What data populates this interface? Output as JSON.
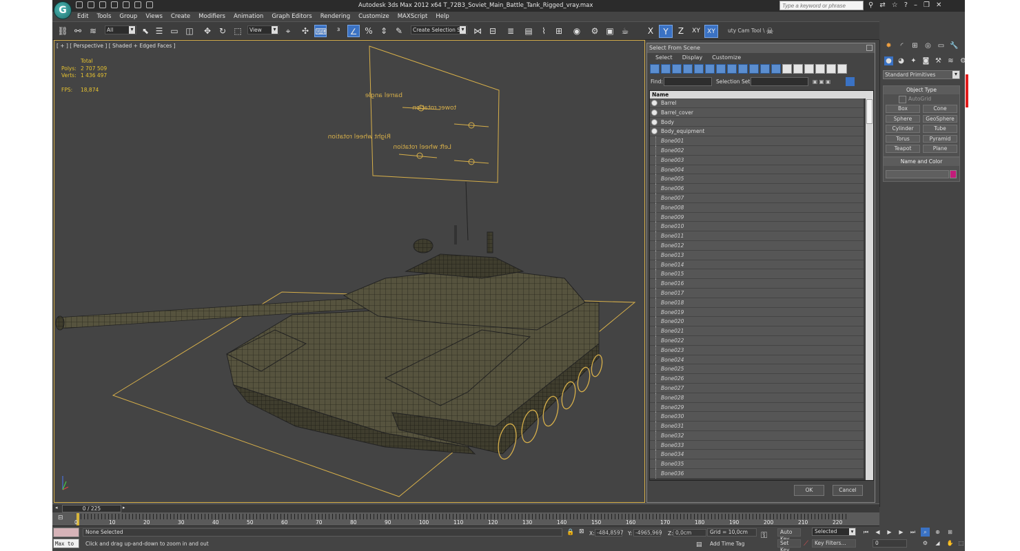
{
  "window": {
    "title": "Autodesk 3ds Max  2012 x64     T_72B3_Soviet_Main_Battle_Tank_Rigged_vray.max",
    "search_placeholder": "Type a keyword or phrase"
  },
  "menu": [
    "Edit",
    "Tools",
    "Group",
    "Views",
    "Create",
    "Modifiers",
    "Animation",
    "Graph Editors",
    "Rendering",
    "Customize",
    "MAXScript",
    "Help"
  ],
  "toolbar": {
    "selection_filter": "All",
    "ref_coord": "View",
    "named_selection": "Create Selection Se",
    "axis_x": "X",
    "axis_y": "Y",
    "axis_z": "Z",
    "axis_xy": "XY",
    "axis_xy2": "XY",
    "cam_tool": "uty Cam Tool \\"
  },
  "viewport": {
    "label": "[ + ] [ Perspective ] [ Shaded + Edged Faces ]",
    "stats_header": "Total",
    "polys_label": "Polys:",
    "polys_value": "2 707 509",
    "verts_label": "Verts:",
    "verts_value": "1 436 497",
    "fps_label": "FPS:",
    "fps_value": "18,874",
    "control_texts": [
      "barrel angle",
      "tower rotation",
      "Right wheel rotation",
      "Left wheel rotation"
    ]
  },
  "dialog": {
    "title": "Select From Scene",
    "menu": [
      "Select",
      "Display",
      "Customize"
    ],
    "find_label": "Find:",
    "selection_set_label": "Selection Set:",
    "column_name": "Name",
    "objects": [
      "Barrel",
      "Barrel_cover",
      "Body",
      "Body_equipment"
    ],
    "bones": [
      "Bone001",
      "Bone002",
      "Bone003",
      "Bone004",
      "Bone005",
      "Bone006",
      "Bone007",
      "Bone008",
      "Bone009",
      "Bone010",
      "Bone011",
      "Bone012",
      "Bone013",
      "Bone014",
      "Bone015",
      "Bone016",
      "Bone017",
      "Bone018",
      "Bone019",
      "Bone020",
      "Bone021",
      "Bone022",
      "Bone023",
      "Bone024",
      "Bone025",
      "Bone026",
      "Bone027",
      "Bone028",
      "Bone029",
      "Bone030",
      "Bone031",
      "Bone032",
      "Bone033",
      "Bone034",
      "Bone035",
      "Bone036"
    ],
    "ok": "OK",
    "cancel": "Cancel"
  },
  "command_panel": {
    "category": "Standard Primitives",
    "object_type_title": "Object Type",
    "autogrid": "AutoGrid",
    "primitives": [
      "Box",
      "Cone",
      "Sphere",
      "GeoSphere",
      "Cylinder",
      "Tube",
      "Torus",
      "Pyramid",
      "Teapot",
      "Plane"
    ],
    "name_color_title": "Name and Color",
    "object_color": "#c21c7a"
  },
  "timeline": {
    "frame_display": "0 / 225",
    "ticks": [
      "0",
      "10",
      "20",
      "30",
      "40",
      "50",
      "60",
      "70",
      "80",
      "90",
      "100",
      "110",
      "120",
      "130",
      "140",
      "150",
      "160",
      "170",
      "180",
      "190",
      "200",
      "210",
      "220"
    ]
  },
  "status": {
    "maxscript": "Max to",
    "selection": "None Selected",
    "prompt": "Click and drag up-and-down to zoom in and out",
    "x_label": "X:",
    "x_value": "-484,8597",
    "y_label": "Y:",
    "y_value": "-4965,969",
    "z_label": "Z:",
    "z_value": "0,0cm",
    "grid": "Grid = 10,0cm",
    "add_time_tag": "Add Time Tag",
    "auto_key": "Auto Key",
    "set_key": "Set Key",
    "key_mode": "Selected",
    "key_filters": "Key Filters...",
    "frame": "0"
  },
  "colors": {
    "accent": "#3a72c4",
    "wire": "#d8b04a",
    "stats": "#e6c230"
  }
}
